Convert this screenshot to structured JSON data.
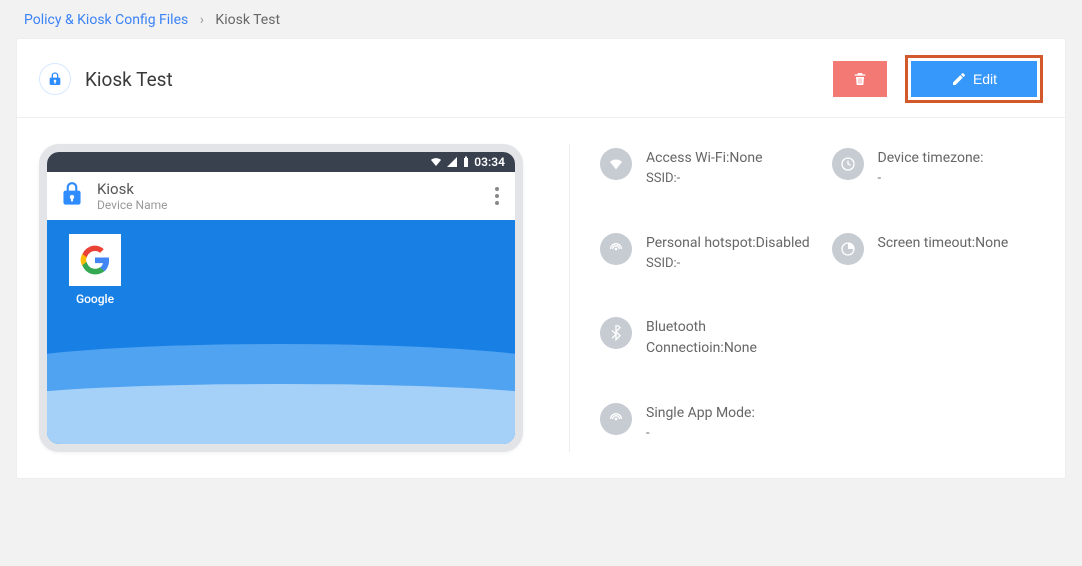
{
  "breadcrumb": {
    "root": "Policy & Kiosk Config Files",
    "current": "Kiosk Test"
  },
  "header": {
    "title": "Kiosk Test",
    "edit_label": "Edit"
  },
  "device_preview": {
    "status_time": "03:34",
    "app_title": "Kiosk",
    "app_subtitle": "Device Name",
    "app_icon_label": "Google"
  },
  "settings": {
    "wifi": {
      "label": "Access Wi-Fi:",
      "value": "None",
      "ssid_label": "SSID:",
      "ssid_value": "-"
    },
    "timezone": {
      "label": "Device timezone:",
      "value": "-"
    },
    "hotspot": {
      "label": "Personal hotspot:",
      "value": "Disabled",
      "ssid_label": "SSID:",
      "ssid_value": "-"
    },
    "screen_timeout": {
      "label": "Screen timeout:",
      "value": "None"
    },
    "bluetooth": {
      "label": "Bluetooth Connectioin:",
      "value": "None"
    },
    "single_app": {
      "label": "Single App Mode:",
      "value": "-"
    }
  }
}
